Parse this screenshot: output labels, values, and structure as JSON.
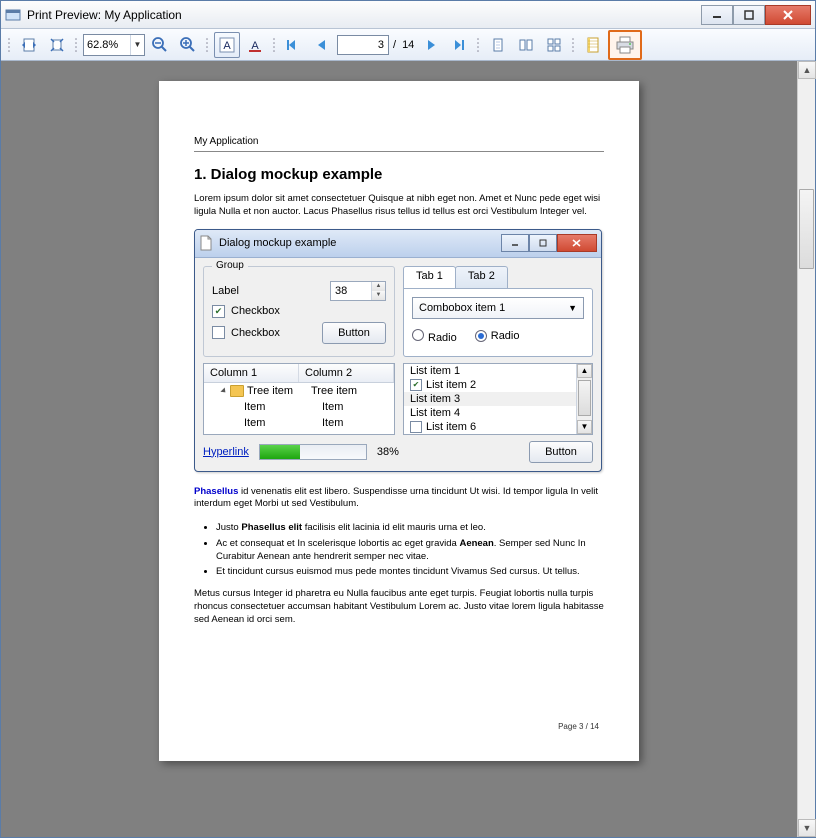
{
  "window": {
    "title": "Print Preview: My Application"
  },
  "toolbar": {
    "zoom": "62.8%",
    "page_current": "3",
    "page_sep": " / ",
    "page_total": "14"
  },
  "page": {
    "header": "My Application",
    "h1": "1. Dialog mockup example",
    "para1": "Lorem ipsum dolor sit amet consectetuer Quisque at nibh eget non. Amet et Nunc pede eget wisi ligula Nulla et non auctor. Lacus Phasellus risus tellus id tellus est orci Vestibulum Integer vel.",
    "para2_lead": "Phasellus",
    "para2_rest": " id venenatis elit est libero. Suspendisse urna tincidunt Ut wisi. Id tempor ligula In velit interdum eget Morbi ut sed Vestibulum.",
    "bullets": [
      {
        "pre": "Justo ",
        "b": "Phasellus elit",
        "post": " facilisis elit lacinia id elit mauris urna et leo."
      },
      {
        "pre": "Ac et consequat et In scelerisque lobortis ac eget gravida ",
        "b": "Aenean",
        "post": ". Semper sed Nunc In Curabitur Aenean ante hendrerit semper nec vitae."
      },
      {
        "pre": "Et tincidunt cursus euismod mus pede montes tincidunt Vivamus Sed cursus. Ut tellus.",
        "b": "",
        "post": ""
      }
    ],
    "para3": "Metus cursus Integer id pharetra eu Nulla faucibus ante eget turpis. Feugiat lobortis nulla turpis rhoncus consectetuer accumsan habitant Vestibulum Lorem ac. Justo vitae lorem ligula habitasse sed Aenean id orci sem.",
    "footer": "Page 3 / 14"
  },
  "dialog": {
    "title": "Dialog mockup example",
    "group_legend": "Group",
    "label_text": "Label",
    "spin_value": "38",
    "checkbox_label": "Checkbox",
    "button_label": "Button",
    "tab1": "Tab 1",
    "tab2": "Tab 2",
    "combo": "Combobox item 1",
    "radio_label": "Radio",
    "tree": {
      "col1": "Column 1",
      "col2": "Column 2",
      "r1c1": "Tree item",
      "r1c2": "Tree item",
      "r2c1": "Item",
      "r2c2": "Item",
      "r3c1": "Item",
      "r3c2": "Item"
    },
    "list": {
      "i1": "List item 1",
      "i2": "List item 2",
      "i3": "List item 3",
      "i4": "List item 4",
      "i6": "List item 6"
    },
    "hyperlink": "Hyperlink",
    "progress_pct": "38%"
  }
}
